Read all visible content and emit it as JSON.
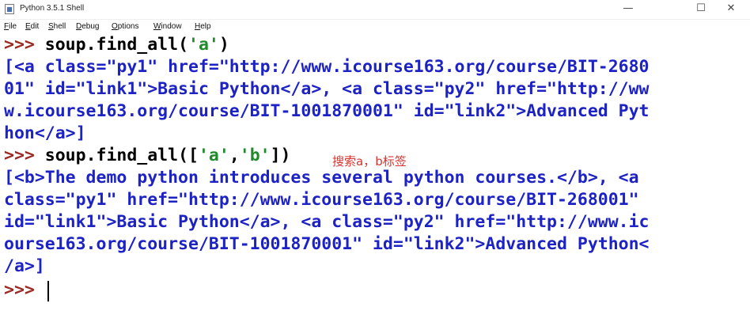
{
  "window": {
    "title": "Python 3.5.1 Shell",
    "minimize_icon": "minimize-icon",
    "maximize_icon": "maximize-icon",
    "close_icon": "close-icon"
  },
  "menu": {
    "items": [
      {
        "label": "File",
        "ul": "F",
        "rest": "ile"
      },
      {
        "label": "Edit",
        "ul": "E",
        "rest": "dit"
      },
      {
        "label": "Shell",
        "ul": "S",
        "rest": "hell"
      },
      {
        "label": "Debug",
        "ul": "D",
        "rest": "ebug"
      },
      {
        "label": "Options",
        "ul": "O",
        "rest": "ptions"
      },
      {
        "label": "Window",
        "ul": "W",
        "rest": "indow"
      },
      {
        "label": "Help",
        "ul": "H",
        "rest": "elp"
      }
    ]
  },
  "console": {
    "prompt": ">>>",
    "cmd1": "soup.find_all(",
    "cmd1_arg": "'a'",
    "cmd1_end": ")",
    "out1": [
      "[<a class=\"py1\" href=\"http://www.icourse163.org/course/BIT-2680",
      "01\" id=\"link1\">Basic Python</a>, <a class=\"py2\" href=\"http://ww",
      "w.icourse163.org/course/BIT-1001870001\" id=\"link2\">Advanced Pyt",
      "hon</a>]"
    ],
    "cmd2": "soup.find_all([",
    "cmd2_arg1": "'a'",
    "cmd2_sep": ",",
    "cmd2_arg2": "'b'",
    "cmd2_end": "])",
    "annotation": "搜索a，b标签",
    "out2": [
      "[<b>The demo python introduces several python courses.</b>, <a",
      "class=\"py1\" href=\"http://www.icourse163.org/course/BIT-268001\"",
      "id=\"link1\">Basic Python</a>, <a class=\"py2\" href=\"http://www.ic",
      "ourse163.org/course/BIT-1001870001\" id=\"link2\">Advanced Python<",
      "/a>]"
    ]
  },
  "colors": {
    "prompt": "#9b2a24",
    "string": "#1f8a2a",
    "output": "#1d22c5",
    "annotation": "#d6332e"
  }
}
